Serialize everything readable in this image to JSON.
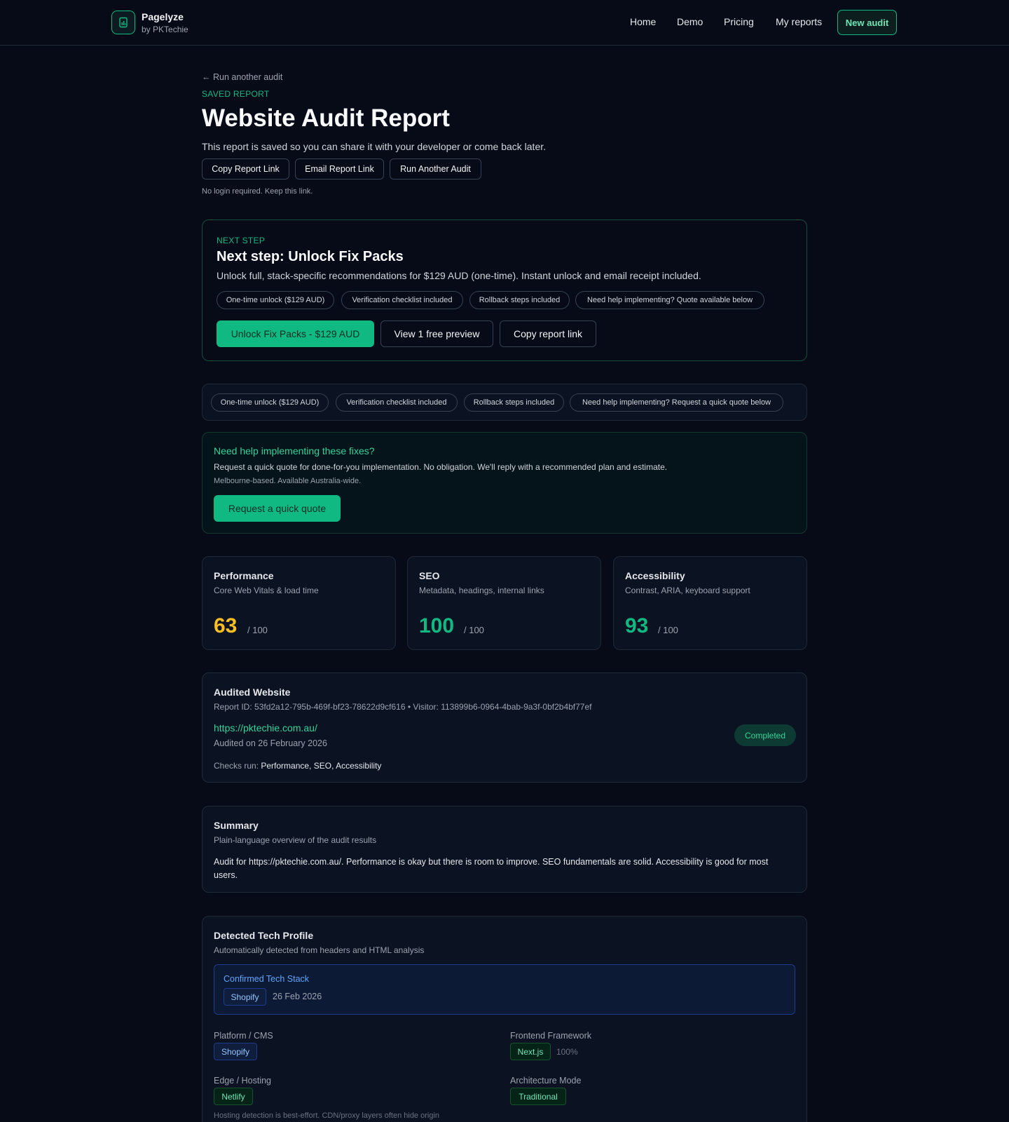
{
  "header": {
    "brand": "Pagelyze",
    "brand_sub": "by PKTechie",
    "nav": [
      "Home",
      "Demo",
      "Pricing",
      "My reports"
    ],
    "new_audit": "New audit"
  },
  "hero": {
    "back_link": "← Run another audit",
    "eyebrow": "SAVED REPORT",
    "title": "Website Audit Report",
    "lead": "This report is saved so you can share it with your developer or come back later.",
    "buttons": [
      "Copy Report Link",
      "Email Report Link",
      "Run Another Audit"
    ],
    "note": "No login required. Keep this link."
  },
  "next_step": {
    "eyebrow": "NEXT STEP",
    "title": "Next step: Unlock Fix Packs",
    "desc": "Unlock full, stack-specific recommendations for $129 AUD (one-time). Instant unlock and email receipt included.",
    "pills": [
      "One-time unlock ($129 AUD)",
      "Verification checklist included",
      "Rollback steps included",
      "Need help implementing? Quote available below"
    ],
    "primary": "Unlock Fix Packs - $129 AUD",
    "secondary": [
      "View 1 free preview",
      "Copy report link"
    ]
  },
  "pill_bar": [
    "One-time unlock ($129 AUD)",
    "Verification checklist included",
    "Rollback steps included",
    "Need help implementing? Request a quick quote below"
  ],
  "help": {
    "title": "Need help implementing these fixes?",
    "desc": "Request a quick quote for done-for-you implementation. No obligation. We'll reply with a recommended plan and estimate.",
    "note": "Melbourne-based. Available Australia-wide.",
    "button": "Request a quick quote"
  },
  "scores": [
    {
      "title": "Performance",
      "sub": "Core Web Vitals & load time",
      "value": "63",
      "max": "/ 100",
      "color": "#fbbf24"
    },
    {
      "title": "SEO",
      "sub": "Metadata, headings, internal links",
      "value": "100",
      "max": "/ 100",
      "color": "#10b981"
    },
    {
      "title": "Accessibility",
      "sub": "Contrast, ARIA, keyboard support",
      "value": "93",
      "max": "/ 100",
      "color": "#10b981"
    }
  ],
  "audited": {
    "title": "Audited Website",
    "ids": "Report ID: 53fd2a12-795b-469f-bf23-78622d9cf616 • Visitor: 113899b6-0964-4bab-9a3f-0bf2b4bf77ef",
    "url": "https://pktechie.com.au/",
    "date": "Audited on 26 February 2026",
    "status": "Completed",
    "checks_label": "Checks run: ",
    "checks": "Performance, SEO, Accessibility"
  },
  "summary": {
    "title": "Summary",
    "sub": "Plain-language overview of the audit results",
    "text": "Audit for https://pktechie.com.au/. Performance is okay but there is room to improve. SEO fundamentals are solid. Accessibility is good for most users."
  },
  "tech": {
    "title": "Detected Tech Profile",
    "sub": "Automatically detected from headers and HTML analysis",
    "confirmed_label": "Confirmed Tech Stack",
    "confirmed_tag": "Shopify",
    "confirmed_date": "26 Feb 2026",
    "platform_label": "Platform / CMS",
    "platform": "Shopify",
    "frontend_label": "Frontend Framework",
    "frontend": "Next.js",
    "frontend_conf": "100%",
    "edge_label": "Edge / Hosting",
    "edge": "Netlify",
    "arch_label": "Architecture Mode",
    "arch": "Traditional",
    "hosting_note": "Hosting detection is best-effort. CDN/proxy layers often hide origin"
  }
}
